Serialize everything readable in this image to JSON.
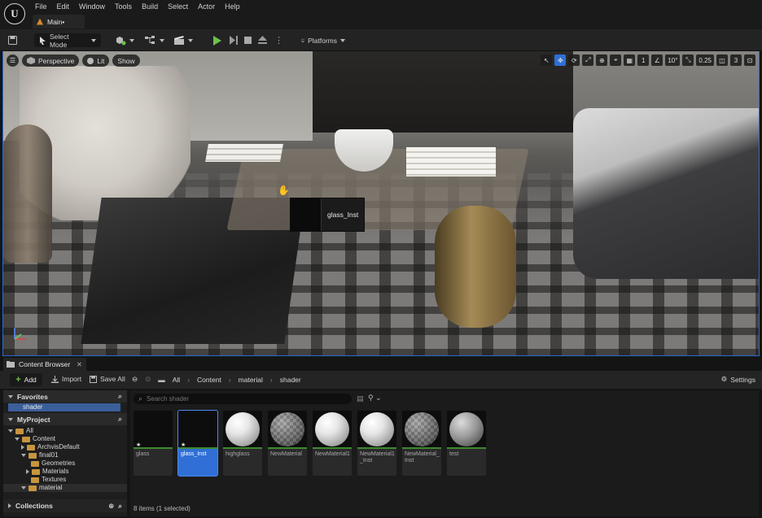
{
  "menu": [
    "File",
    "Edit",
    "Window",
    "Tools",
    "Build",
    "Select",
    "Actor",
    "Help"
  ],
  "document_tab": "Main•",
  "toolbar": {
    "select_mode": "Select Mode",
    "platforms": "Platforms"
  },
  "viewport": {
    "perspective": "Perspective",
    "lit": "Lit",
    "show": "Show",
    "grid_size": "1",
    "rotation_snap": "10°",
    "scale_snap": "0.25",
    "camera_speed": "3",
    "drag_tooltip": "glass_Inst"
  },
  "content_browser": {
    "tab": "Content Browser",
    "add": "Add",
    "import": "Import",
    "save_all": "Save All",
    "breadcrumb": [
      "All",
      "Content",
      "material",
      "shader"
    ],
    "settings": "Settings",
    "search_placeholder": "Search shader",
    "favorites": "Favorites",
    "favorite_item": "shader",
    "project": "MyProject",
    "tree": [
      {
        "label": "All",
        "level": 0
      },
      {
        "label": "Content",
        "level": 1
      },
      {
        "label": "ArchvisDefault",
        "level": 2
      },
      {
        "label": "final01",
        "level": 2
      },
      {
        "label": "Geometries",
        "level": 3
      },
      {
        "label": "Materials",
        "level": 3
      },
      {
        "label": "Textures",
        "level": 3
      },
      {
        "label": "material",
        "level": 2
      }
    ],
    "collections": "Collections",
    "assets": [
      {
        "name": "glass",
        "preview": "dark",
        "starred": true,
        "selected": false
      },
      {
        "name": "glass_Inst",
        "preview": "dark",
        "starred": true,
        "selected": true
      },
      {
        "name": "highglass",
        "preview": "white",
        "starred": false,
        "selected": false
      },
      {
        "name": "NewMaterial",
        "preview": "checker",
        "starred": false,
        "selected": false
      },
      {
        "name": "NewMaterial1",
        "preview": "white",
        "starred": false,
        "selected": false
      },
      {
        "name": "NewMaterial1_Inst",
        "preview": "white",
        "starred": false,
        "selected": false
      },
      {
        "name": "NewMaterial_Inst",
        "preview": "checker",
        "starred": false,
        "selected": false
      },
      {
        "name": "test",
        "preview": "grey",
        "starred": false,
        "selected": false
      }
    ],
    "status": "8 items (1 selected)"
  },
  "colors": {
    "accent": "#2f6fd6",
    "play": "#6cc24a",
    "folder": "#c8953f"
  }
}
